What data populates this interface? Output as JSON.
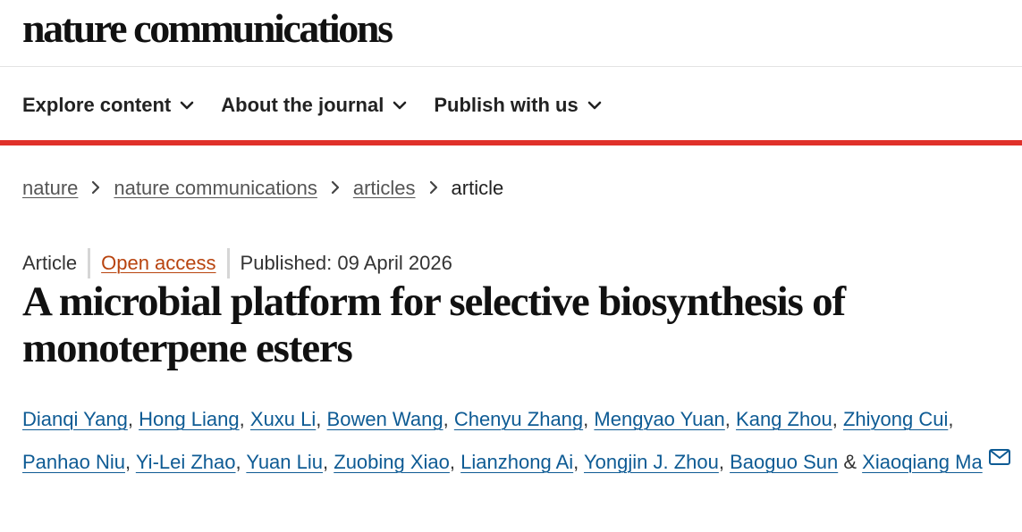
{
  "brand": {
    "logo_text": "nature communications"
  },
  "nav": {
    "items": [
      {
        "label": "Explore content",
        "icon": "chevron-down-icon"
      },
      {
        "label": "About the journal",
        "icon": "chevron-down-icon"
      },
      {
        "label": "Publish with us",
        "icon": "chevron-down-icon"
      }
    ]
  },
  "breadcrumb": {
    "items": [
      "nature",
      "nature communications",
      "articles"
    ],
    "current": "article",
    "separator_icon": "chevron-right-icon"
  },
  "article": {
    "type": "Article",
    "access": "Open access",
    "published": "Published: 09 April 2026",
    "title": "A microbial platform for selective biosynthesis of monoterpene esters",
    "authors": [
      "Dianqi Yang",
      "Hong Liang",
      "Xuxu Li",
      "Bowen Wang",
      "Chenyu Zhang",
      "Mengyao Yuan",
      "Kang Zhou",
      "Zhiyong Cui",
      "Panhao Niu",
      "Yi-Lei Zhao",
      "Yuan Liu",
      "Zuobing Xiao",
      "Lianzhong Ai",
      "Yongjin J. Zhou",
      "Baoguo Sun",
      "Xiaoqiang Ma"
    ],
    "author_separator": ",",
    "last_author_joiner": "&",
    "contact_icon": "mail-icon"
  },
  "colors": {
    "accent_red": "#e0312a",
    "link_blue": "#0e5b94",
    "open_access_orange": "#b8430e"
  }
}
